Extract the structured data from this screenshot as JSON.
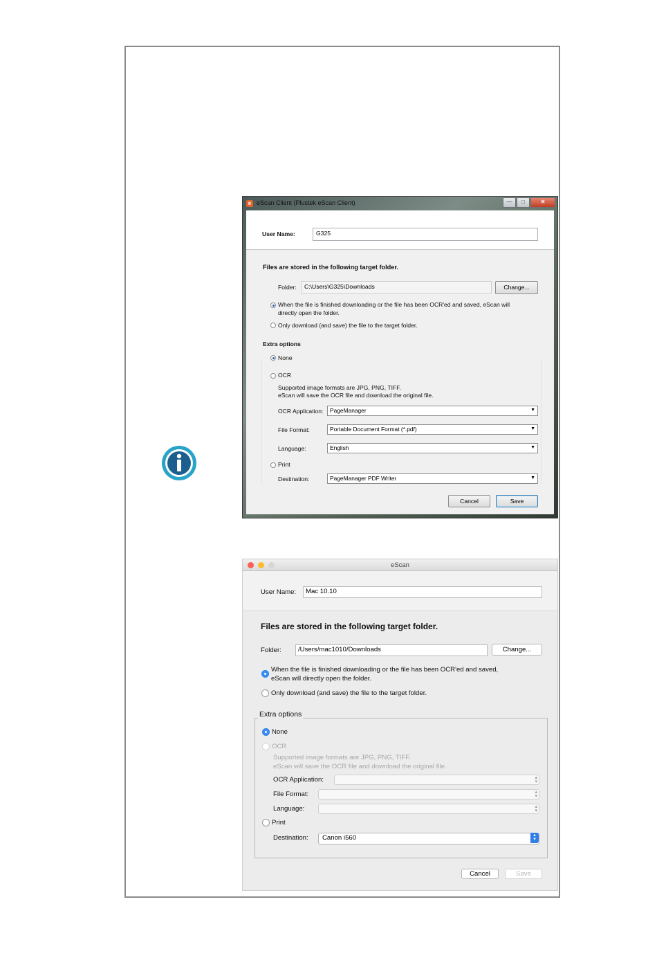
{
  "windows_dialog": {
    "title": "eScan Client (Plustek eScan Client)",
    "app_icon": "escan-app-icon",
    "window_controls": {
      "minimize": "—",
      "maximize": "□",
      "close": "✕"
    },
    "user_name_label": "User Name:",
    "user_name_value": "G325",
    "target_heading": "Files are stored in the following target folder.",
    "folder_label": "Folder:",
    "folder_value": "C:\\Users\\G325\\Downloads",
    "change_button": "Change...",
    "option_open_folder_line1": "When the file is finished downloading or the file has been OCR'ed and saved, eScan will",
    "option_open_folder_line2": "directly open the folder.",
    "option_download_only": "Only download (and save) the file to the target folder.",
    "extra_options_heading": "Extra options",
    "none_label": "None",
    "ocr_label": "OCR",
    "ocr_desc_line1": "Supported image formats are JPG, PNG, TIFF.",
    "ocr_desc_line2": "eScan will save the OCR file and download the original file.",
    "ocr_app_label": "OCR Application:",
    "ocr_app_value": "PageManager",
    "file_format_label": "File Format:",
    "file_format_value": "Portable Document Format (*.pdf)",
    "language_label": "Language:",
    "language_value": "English",
    "print_label": "Print",
    "destination_label": "Destination:",
    "destination_value": "PageManager PDF Writer",
    "cancel_button": "Cancel",
    "save_button": "Save"
  },
  "mac_dialog": {
    "title": "eScan",
    "user_name_label": "User Name:",
    "user_name_value": "Mac 10.10",
    "target_heading": "Files are stored in the following target folder.",
    "folder_label": "Folder:",
    "folder_value": "/Users/mac1010/Downloads",
    "change_button": "Change...",
    "option_open_folder_line1": "When the file is finished downloading or the file has been OCR'ed and saved,",
    "option_open_folder_line2": "eScan will directly open the folder.",
    "option_download_only": "Only download (and save) the file to the target folder.",
    "extra_options_heading": "Extra options",
    "none_label": "None",
    "ocr_label": "OCR",
    "ocr_desc_line1": "Supported image formats are JPG, PNG, TIFF.",
    "ocr_desc_line2": "eScan will save the OCR file and download the original file.",
    "ocr_app_label": "OCR Application:",
    "file_format_label": "File Format:",
    "language_label": "Language:",
    "print_label": "Print",
    "destination_label": "Destination:",
    "destination_value": "Canon i560",
    "cancel_button": "Cancel",
    "save_button": "Save",
    "traffic_light_colors": {
      "close": "#fc5f57",
      "minimize": "#fdbc2e",
      "zoom": "#d6d6d6"
    },
    "accent_color": "#3b8ef5"
  },
  "info_icon": {
    "name": "info-icon",
    "color": "#2aa3c8"
  }
}
